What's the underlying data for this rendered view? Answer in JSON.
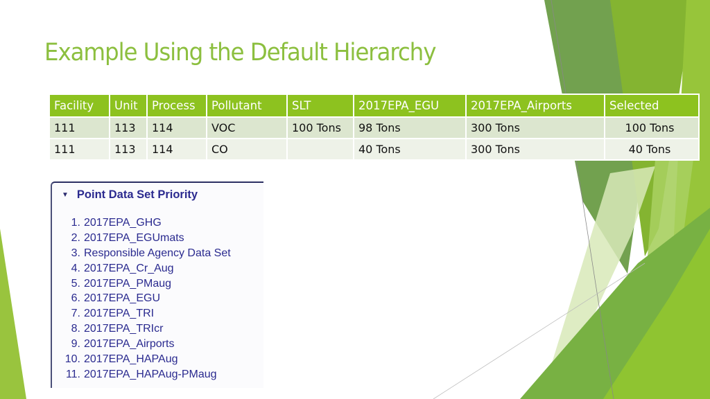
{
  "slide": {
    "title": "Example Using the Default Hierarchy",
    "accent_color": "#8cbf3f"
  },
  "table": {
    "headers": [
      "Facility",
      "Unit",
      "Process",
      "Pollutant",
      "SLT",
      "2017EPA_EGU",
      "2017EPA_Airports",
      "Selected"
    ],
    "rows": [
      [
        "111",
        "113",
        "114",
        "VOC",
        "100 Tons",
        "98 Tons",
        "300 Tons",
        "100 Tons"
      ],
      [
        "111",
        "113",
        "114",
        "CO",
        "",
        "40 Tons",
        "300 Tons",
        "40 Tons"
      ]
    ],
    "header_color": "#8dc21f"
  },
  "panel": {
    "title": "Point Data Set Priority",
    "caret_icon": "triangle-down",
    "items": [
      {
        "num": "1.",
        "label": "2017EPA_GHG"
      },
      {
        "num": "2.",
        "label": "2017EPA_EGUmats"
      },
      {
        "num": "3.",
        "label": "Responsible Agency Data Set"
      },
      {
        "num": "4.",
        "label": "2017EPA_Cr_Aug"
      },
      {
        "num": "5.",
        "label": "2017EPA_PMaug"
      },
      {
        "num": "6.",
        "label": "2017EPA_EGU"
      },
      {
        "num": "7.",
        "label": "2017EPA_TRI"
      },
      {
        "num": "8.",
        "label": "2017EPA_TRIcr"
      },
      {
        "num": "9.",
        "label": "2017EPA_Airports"
      },
      {
        "num": "10.",
        "label": "2017EPA_HAPAug"
      },
      {
        "num": "11.",
        "label": "2017EPA_HAPAug-PMaug"
      }
    ]
  }
}
